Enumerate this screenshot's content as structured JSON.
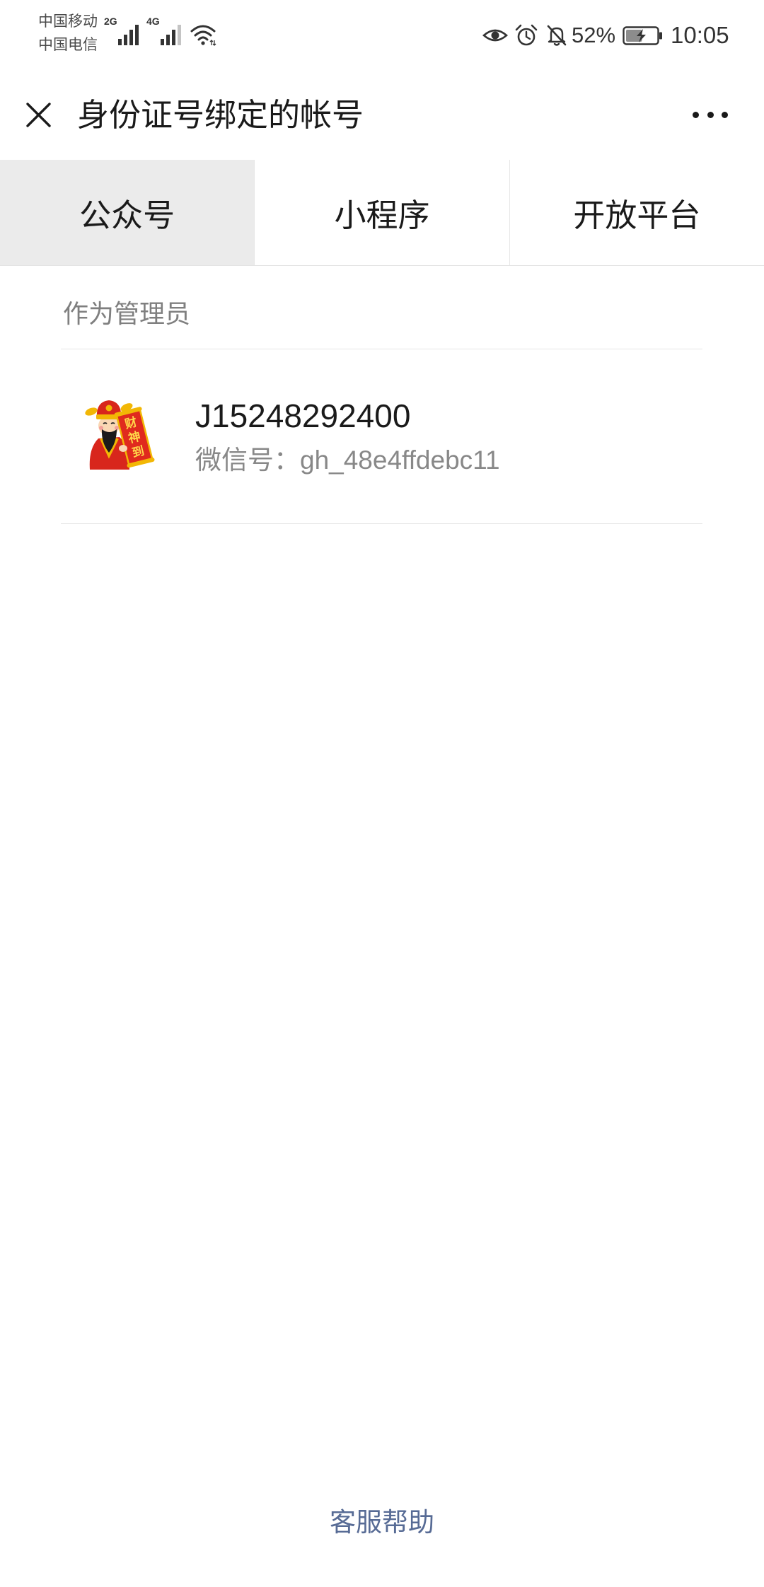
{
  "status_bar": {
    "carrier_1": "中国移动",
    "carrier_2": "中国电信",
    "sim1": {
      "network": "2G",
      "signal_level": 4
    },
    "sim2": {
      "network": "4G",
      "signal_level": 3
    },
    "wifi_icon": "wifi-icon",
    "indicator_icons": [
      "eye-comfort-icon",
      "alarm-icon",
      "notifications-off-icon"
    ],
    "battery": {
      "percent_text": "52%",
      "level": 0.52,
      "charging": true
    },
    "time": "10:05"
  },
  "header": {
    "close_icon": "close-icon",
    "title": "身份证号绑定的帐号",
    "more_icon": "more-icon"
  },
  "tabs": [
    {
      "label": "公众号",
      "selected": true
    },
    {
      "label": "小程序",
      "selected": false
    },
    {
      "label": "开放平台",
      "selected": false
    }
  ],
  "section": {
    "title": "作为管理员"
  },
  "accounts": [
    {
      "name": "J15248292400",
      "wechat_id_label": "微信号：",
      "wechat_id": "gh_48e4ffdebc11",
      "avatar_lettering": [
        "财",
        "神",
        "到"
      ]
    }
  ],
  "footer": {
    "help_link": "客服帮助"
  },
  "colors": {
    "primary_text": "#1a1a1a",
    "secondary_text": "#888888",
    "link": "#576b95",
    "selected_tab_bg": "#ebebeb",
    "divider": "#e5e5e5"
  }
}
